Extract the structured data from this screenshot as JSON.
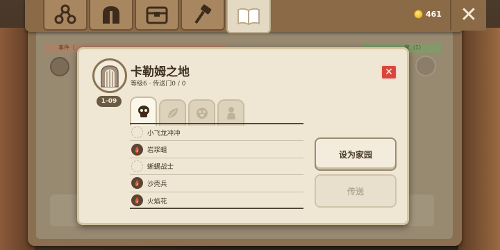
{
  "topbar": {
    "tabs": [
      {
        "name": "skill-tree",
        "icon": "tree-icon",
        "active": false
      },
      {
        "name": "helmet",
        "icon": "helmet-icon",
        "active": false
      },
      {
        "name": "chest",
        "icon": "chest-icon",
        "active": false
      },
      {
        "name": "craft",
        "icon": "hammer-icon",
        "active": false
      },
      {
        "name": "map-book",
        "icon": "book-icon",
        "active": true
      }
    ],
    "coins": "461",
    "close_icon": "close-x-icon"
  },
  "background": {
    "left_strip_label": "事件（",
    "right_strip_label": "家（1）"
  },
  "modal": {
    "title": "卡勒姆之地",
    "subtitle": "等级6 · 传送门0 / 0",
    "level_range": "1-09",
    "category_tabs": [
      {
        "name": "monsters",
        "icon": "skull-icon",
        "active": true
      },
      {
        "name": "plants",
        "icon": "leaf-icon",
        "active": false
      },
      {
        "name": "creatures",
        "icon": "paw-icon",
        "active": false
      },
      {
        "name": "npc",
        "icon": "person-icon",
        "active": false
      }
    ],
    "mobs": [
      {
        "name": "小飞龙冲冲",
        "icon": "empty-slot-icon"
      },
      {
        "name": "岩浆蛆",
        "icon": "fire-icon"
      },
      {
        "name": "蜥蜴战士",
        "icon": "empty-slot-icon"
      },
      {
        "name": "沙壳兵",
        "icon": "fire-icon"
      },
      {
        "name": "火焰花",
        "icon": "fire-icon"
      }
    ],
    "buttons": {
      "set_home": "设为家园",
      "teleport": "传送"
    }
  }
}
